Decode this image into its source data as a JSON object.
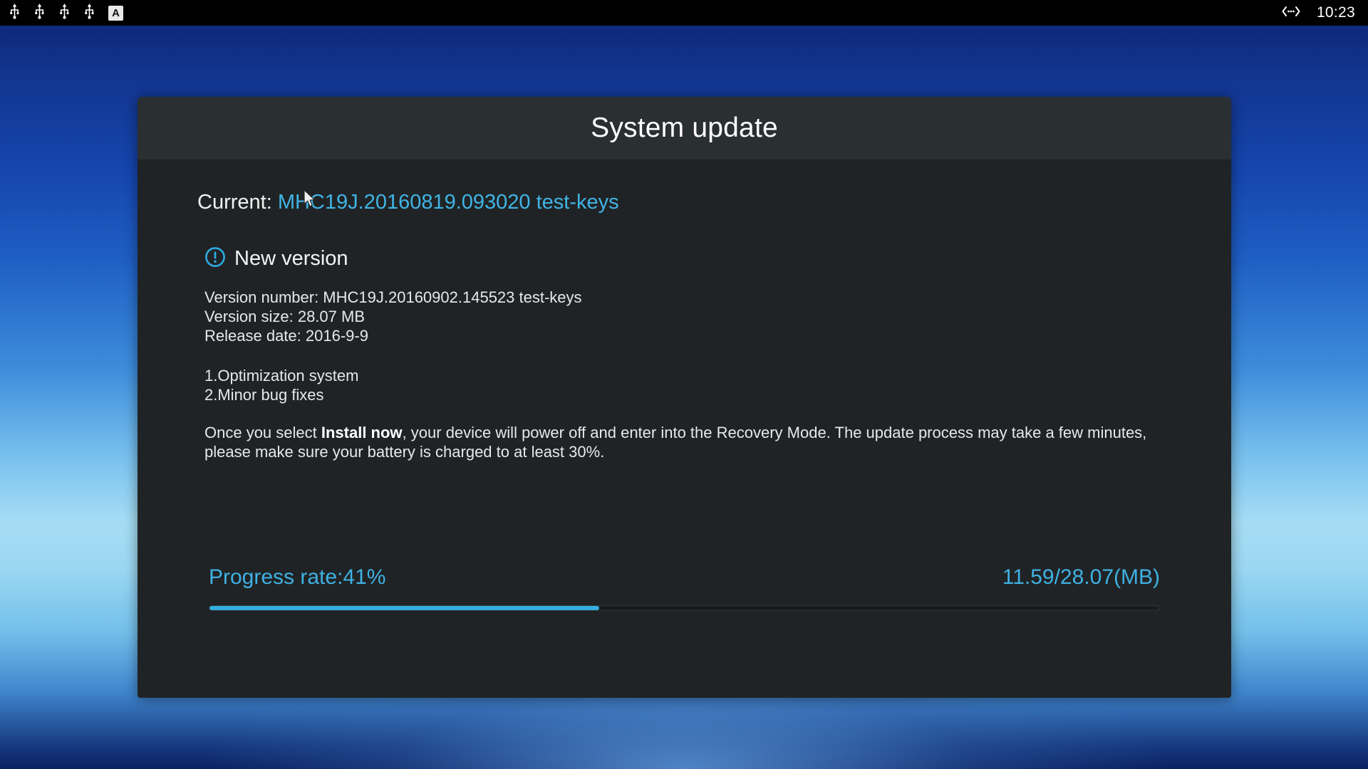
{
  "statusbar": {
    "left_icons": [
      {
        "name": "usb-icon",
        "label": "USB"
      },
      {
        "name": "usb-icon",
        "label": "USB"
      },
      {
        "name": "usb-icon",
        "label": "USB"
      },
      {
        "name": "usb-icon",
        "label": "USB"
      },
      {
        "name": "input-method-icon",
        "label": "A"
      }
    ],
    "input_method_glyph": "A",
    "network_icon": "ethernet-icon",
    "clock": "10:23"
  },
  "dialog": {
    "title": "System update",
    "current": {
      "label": "Current: ",
      "version": "MHC19J.20160819.093020 test-keys"
    },
    "new_version": {
      "heading": "New version",
      "icon": "alert-circle-icon",
      "version_number_line": "Version number: MHC19J.20160902.145523 test-keys",
      "version_size_line": "Version size: 28.07 MB",
      "release_date_line": "Release date: 2016-9-9",
      "changelog": [
        "1.Optimization system",
        "2.Minor bug fixes"
      ]
    },
    "notice": {
      "before": "Once you select ",
      "emphasis": "Install now",
      "after": ", your device will power off and enter into the Recovery Mode. The update process may take a few minutes, please make sure your battery is charged to at least 30%."
    },
    "progress": {
      "rate_label": "Progress rate:41%",
      "percent": 41,
      "size_label": "11.59/28.07(MB)",
      "downloaded_mb": "11.59",
      "total_mb": "28.07",
      "unit": "MB"
    }
  },
  "colors": {
    "accent": "#3fb1e3",
    "progress_fill": "#34aee0",
    "dialog_bg": "#202325",
    "dialog_header_bg": "#2a2f31",
    "text": "#e8e8e8",
    "statusbar_bg": "#000000"
  }
}
